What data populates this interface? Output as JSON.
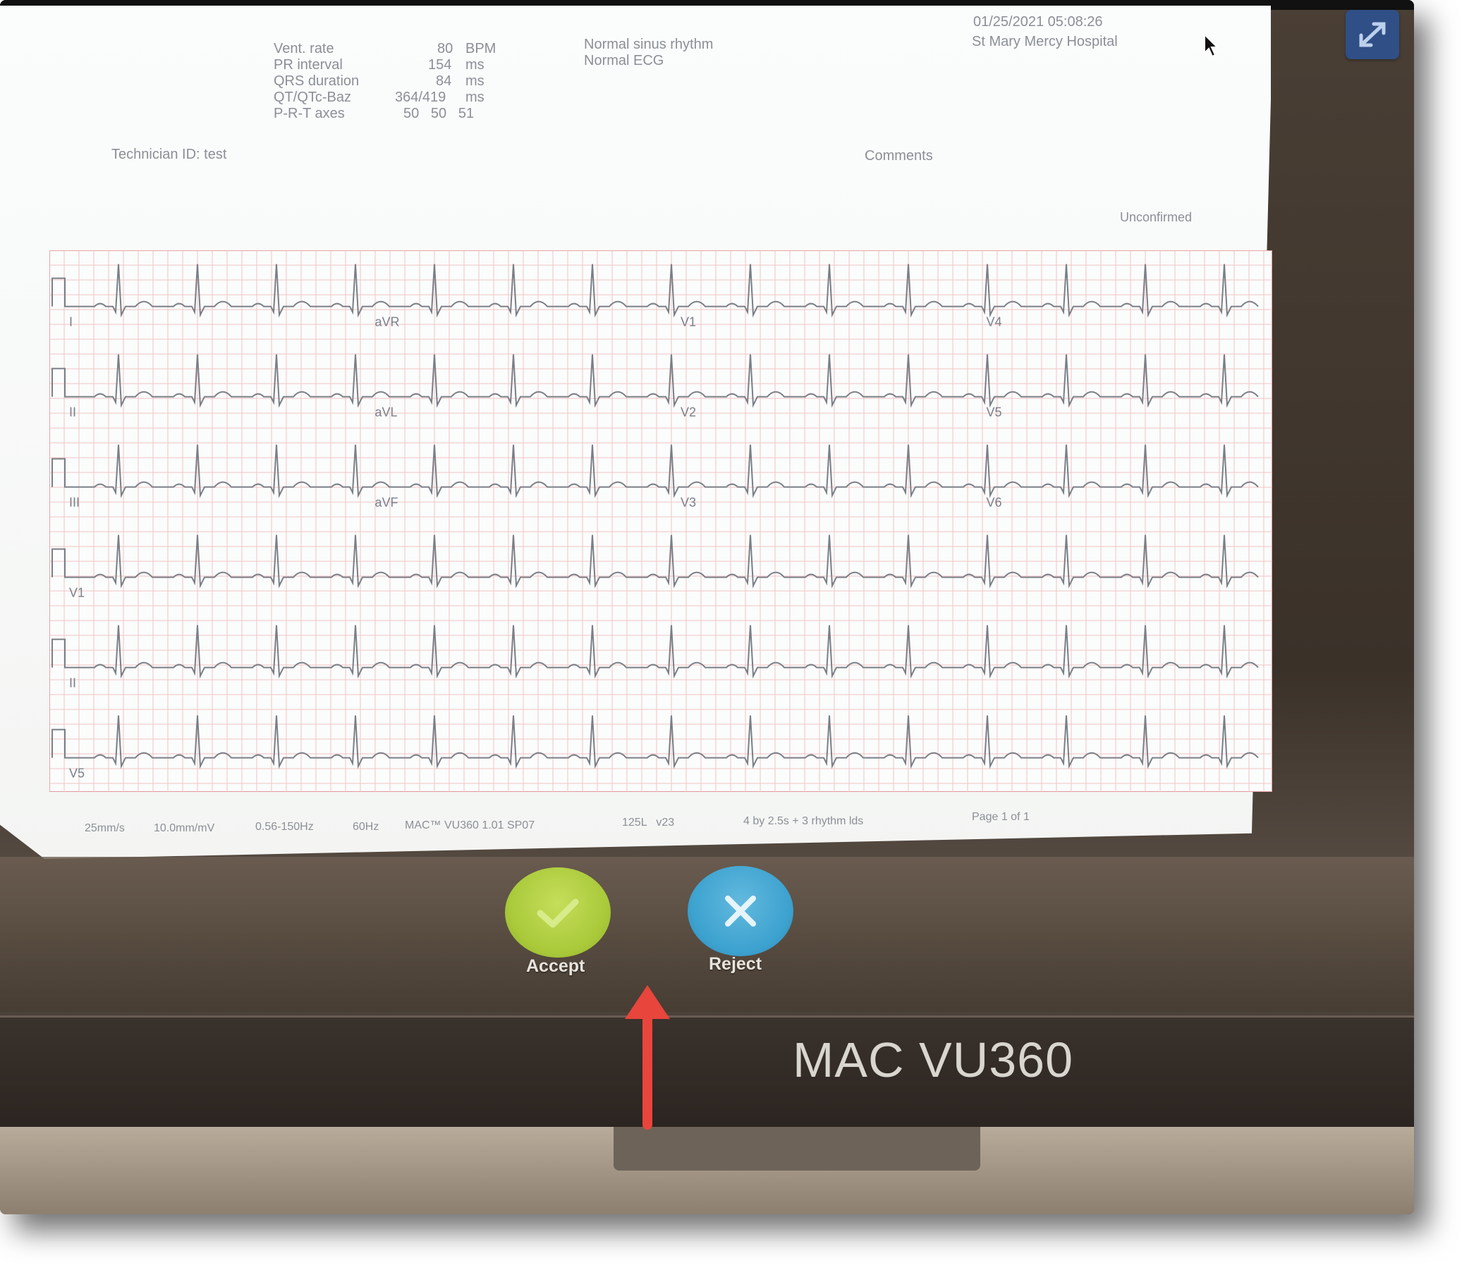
{
  "report": {
    "measurements": [
      {
        "label": "Vent. rate",
        "value": "80",
        "unit": "BPM"
      },
      {
        "label": "PR interval",
        "value": "154",
        "unit": "ms"
      },
      {
        "label": "QRS duration",
        "value": "84",
        "unit": "ms"
      },
      {
        "label": "QT/QTc-Baz",
        "value": "364/419",
        "unit": "ms"
      },
      {
        "label": "P-R-T axes",
        "value": "50   50   51",
        "unit": ""
      }
    ],
    "interpretation": [
      "Normal sinus rhythm",
      "Normal ECG"
    ],
    "datetime": "01/25/2021 05:08:26",
    "hospital": "St Mary Mercy Hospital",
    "technician": "Technician ID: test",
    "comments_label": "Comments",
    "status": "Unconfirmed",
    "leads": [
      "I",
      "aVR",
      "V1",
      "V4",
      "II",
      "aVL",
      "V2",
      "V5",
      "III",
      "aVF",
      "V3",
      "V6",
      "V1",
      "II",
      "V5"
    ],
    "footer": {
      "speed": "25mm/s",
      "gain": "10.0mm/mV",
      "filter": "0.56-150Hz",
      "notch": "60Hz",
      "device": "MAC™ VU360 1.01 SP07",
      "misc": "125L   v23",
      "format": "4 by 2.5s + 3 rhythm lds",
      "page": "Page 1 of 1"
    }
  },
  "actions": {
    "accept_label": "Accept",
    "reject_label": "Reject"
  },
  "device_brand": "MAC VU360",
  "icons": {
    "expand": "expand-icon",
    "accept": "checkmark-icon",
    "reject": "close-icon",
    "cursor": "mouse-pointer-icon",
    "annotation": "red-up-arrow-icon"
  },
  "colors": {
    "accept": "#a9c93a",
    "reject": "#3da2cf",
    "grid": "#f0b7b7",
    "trace": "#7a7f86",
    "arrow": "#e8453c"
  }
}
